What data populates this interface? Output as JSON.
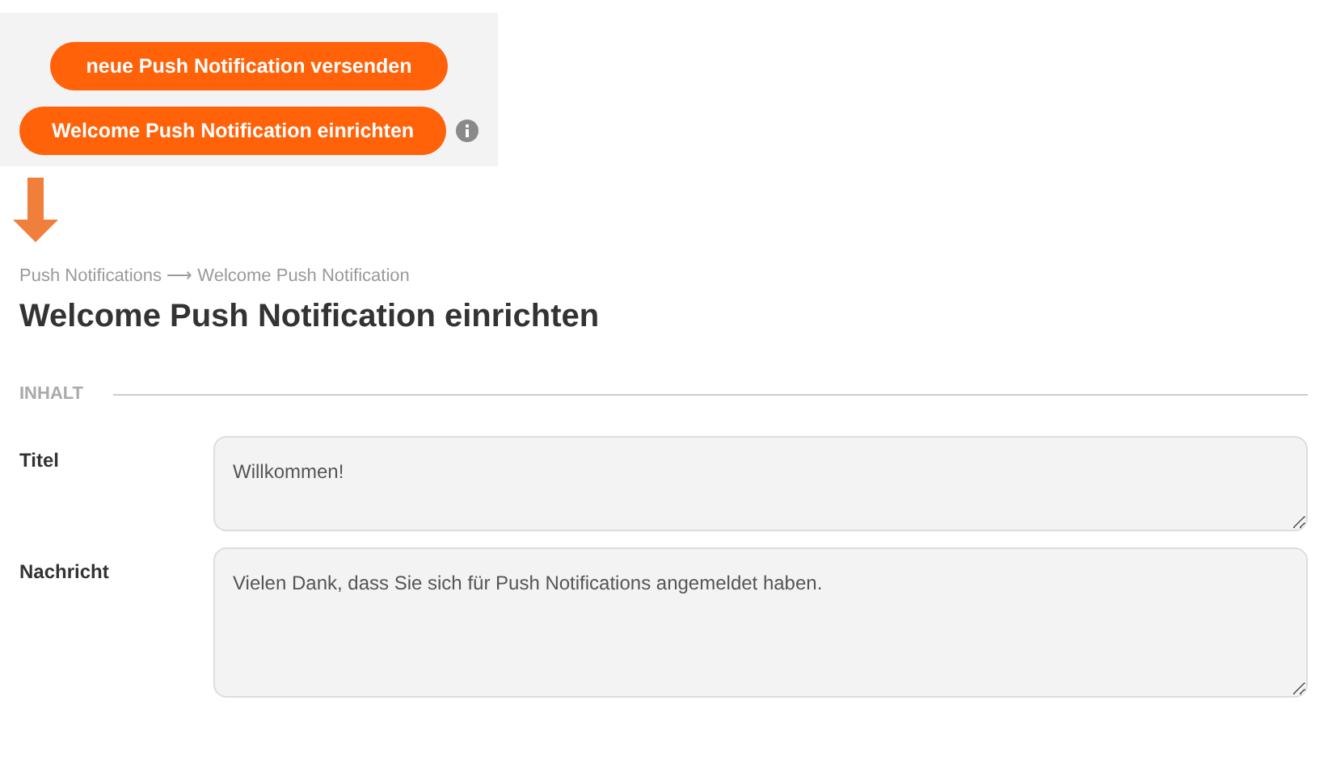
{
  "actions": [
    {
      "label": "neue Push Notification versenden",
      "info": false
    },
    {
      "label": "Welcome Push Notification einrichten",
      "info": true
    }
  ],
  "breadcrumb": "Push Notifications ⟶ Welcome Push Notification",
  "title": "Welcome Push Notification einrichten",
  "section": "INHALT",
  "fields": [
    {
      "label": "Titel",
      "value": "Willkommen!"
    },
    {
      "label": "Nachricht",
      "value": "Vielen Dank, dass Sie sich für Push Notifications angemeldet haben."
    }
  ]
}
